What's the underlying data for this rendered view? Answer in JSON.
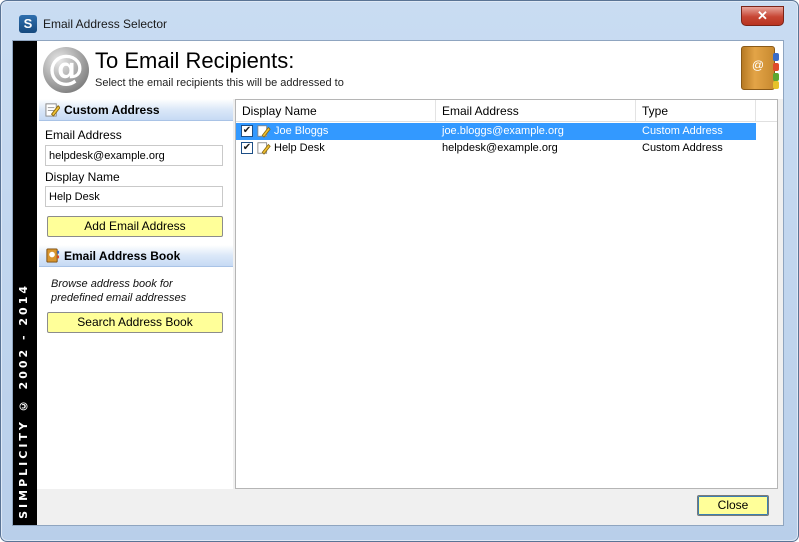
{
  "window": {
    "title": "Email Address Selector",
    "app_icon_letter": "S",
    "close_glyph": "✕"
  },
  "branding": {
    "text": "SIMPLICITY © 2002 - 2014"
  },
  "header": {
    "icon_glyph": "@",
    "title": "To Email Recipients:",
    "subtitle": "Select the email recipients this will be addressed to",
    "book_icon": "address-book-icon"
  },
  "custom_address": {
    "section_title": "Custom Address",
    "email_label": "Email Address",
    "email_value": "helpdesk@example.org",
    "display_label": "Display Name",
    "display_value": "Help Desk",
    "add_button": "Add Email Address"
  },
  "address_book": {
    "section_title": "Email Address Book",
    "description_line1": "Browse address book for",
    "description_line2": "predefined email addresses",
    "search_button": "Search Address Book"
  },
  "recipients": {
    "columns": [
      "Display Name",
      "Email Address",
      "Type"
    ],
    "rows": [
      {
        "checked": true,
        "selected": true,
        "name": "Joe Bloggs",
        "email": "joe.bloggs@example.org",
        "type": "Custom Address"
      },
      {
        "checked": true,
        "selected": false,
        "name": "Help Desk",
        "email": "helpdesk@example.org",
        "type": "Custom Address"
      }
    ]
  },
  "footer": {
    "close_button": "Close"
  },
  "colors": {
    "accent_button": "#ffff99",
    "selection": "#3399ff",
    "section_header": "#c6daf4"
  }
}
